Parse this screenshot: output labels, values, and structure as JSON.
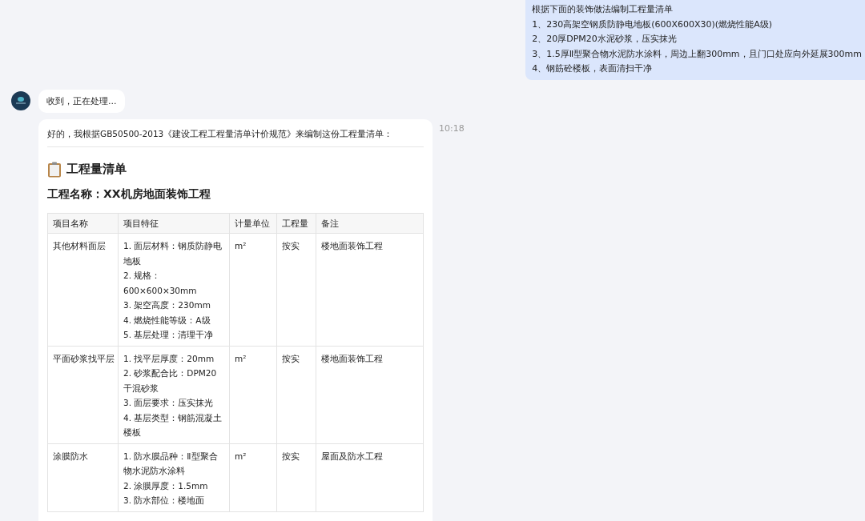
{
  "user_message": {
    "lines": [
      "根据下面的装饰做法编制工程量清单",
      "1、230高架空钢质防静电地板(600X600X30)(燃烧性能A级)",
      "2、20厚DPM20水泥砂浆，压实抹光",
      "3、1.5厚Ⅱ型聚合物水泥防水涂料，周边上翻300mm，且门口处应向外延展300mm",
      "4、钢筋砼楼板，表面清扫干净"
    ]
  },
  "status_message": {
    "text": "收到，正在处理..."
  },
  "reply": {
    "intro": "好的，我根据GB50500-2013《建设工程工程量清单计价规范》来编制这份工程量清单：",
    "time": "10:18",
    "heading": "工程量清单",
    "project_title": "工程名称：XX机房地面装饰工程",
    "table": {
      "columns": [
        "项目名称",
        "项目特征",
        "计量单位",
        "工程量",
        "备注"
      ],
      "rows": [
        {
          "name": "其他材料面层",
          "features": [
            "1. 面层材料：钢质防静电地板",
            "2. 规格：600×600×30mm",
            "3. 架空高度：230mm",
            "4. 燃烧性能等级：A级",
            "5. 基层处理：清理干净"
          ],
          "unit": "m²",
          "quantity": "按实",
          "note": "楼地面装饰工程"
        },
        {
          "name": "平面砂浆找平层",
          "features": [
            "1. 找平层厚度：20mm",
            "2. 砂浆配合比：DPM20干混砂浆",
            "3. 面层要求：压实抹光",
            "4. 基层类型：钢筋混凝土楼板"
          ],
          "unit": "m²",
          "quantity": "按实",
          "note": "楼地面装饰工程"
        },
        {
          "name": "涂膜防水",
          "features": [
            "1. 防水膜品种：Ⅱ型聚合物水泥防水涂料",
            "2. 涂膜厚度：1.5mm",
            "3. 防水部位：楼地面"
          ],
          "unit": "m²",
          "quantity": "按实",
          "note": "屋面及防水工程"
        }
      ]
    }
  }
}
